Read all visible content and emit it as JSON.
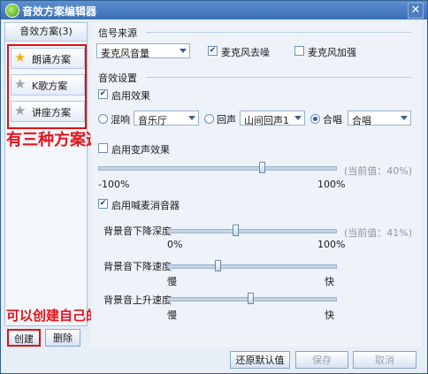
{
  "window": {
    "title": "音效方案编辑器",
    "close_glyph": "✕"
  },
  "sidebar": {
    "header": "音效方案(3)",
    "items": [
      {
        "label": "朗诵方案",
        "icon": "star-gold-icon"
      },
      {
        "label": "K歌方案",
        "icon": "star-gray-icon"
      },
      {
        "label": "讲座方案",
        "icon": "star-gray-icon"
      }
    ],
    "create_label": "创建",
    "delete_label": "删除"
  },
  "annotations": {
    "plans": "有三种方案选择",
    "create": "可以创建自己的方案"
  },
  "signal_source": {
    "title": "信号来源",
    "source_select": "麦克风音量",
    "denoise_label": "麦克风去噪",
    "denoise_checked": true,
    "boost_label": "麦克风加强",
    "boost_checked": false
  },
  "sound_settings": {
    "title": "音效设置",
    "enable_effect_label": "启用效果",
    "enable_effect_checked": true,
    "reverb_label": "混响",
    "reverb_select": "音乐厅",
    "echo_label": "回声",
    "echo_select": "山间回声1",
    "chorus_label": "合唱",
    "chorus_select": "合唱",
    "selected_mode": "chorus",
    "voice_change_label": "启用变声效果",
    "voice_change_checked": false,
    "voice_slider": {
      "min_label": "-100%",
      "max_label": "100%",
      "current": "(当前值：40%)",
      "value_percent": 40
    },
    "vocal_remove_label": "启用喊麦消音器",
    "vocal_remove_checked": true,
    "bg_depth": {
      "label": "背景音下降深度",
      "min_label": "0%",
      "max_label": "100%",
      "current": "(当前值：41%)",
      "value_percent": 41
    },
    "bg_fall_speed": {
      "label": "背景音下降速度",
      "min_label": "慢",
      "max_label": "快",
      "value_fraction": 0.3
    },
    "bg_rise_speed": {
      "label": "背景音上升速度",
      "min_label": "慢",
      "max_label": "快",
      "value_fraction": 0.5
    }
  },
  "footer": {
    "restore_label": "还原默认值",
    "save_label": "保存",
    "cancel_label": "取消"
  }
}
